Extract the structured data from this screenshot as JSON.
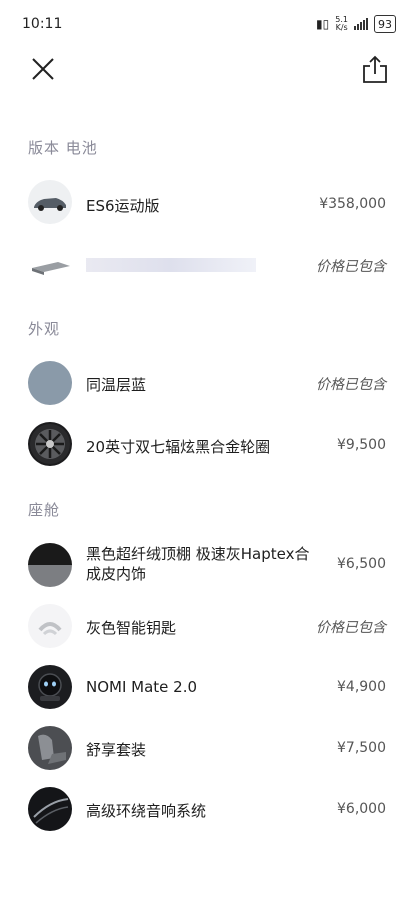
{
  "status_bar": {
    "time": "10:11",
    "net_speed_top": "5.1",
    "net_speed_bottom": "K/s",
    "battery": "93"
  },
  "sections": {
    "version_battery": "版本 电池",
    "exterior": "外观",
    "cabin": "座舱"
  },
  "items": {
    "version": {
      "name": "ES6运动版",
      "price": "¥358,000"
    },
    "battery": {
      "name": "",
      "price": "价格已包含"
    },
    "paint": {
      "name": "同温层蓝",
      "price": "价格已包含",
      "color": "#8a9aa9"
    },
    "wheels": {
      "name": "20英寸双七辐炫黑合金轮圈",
      "price": "¥9,500"
    },
    "interior": {
      "name_line1": "黑色超纤绒顶棚 极速灰Haptex合",
      "name_line2": "成皮内饰",
      "price": "¥6,500"
    },
    "key": {
      "name": "灰色智能钥匙",
      "price": "价格已包含"
    },
    "nomi": {
      "name": "NOMI Mate 2.0",
      "price": "¥4,900"
    },
    "comfort": {
      "name": "舒享套装",
      "price": "¥7,500"
    },
    "audio": {
      "name": "高级环绕音响系统",
      "price": "¥6,000"
    }
  }
}
